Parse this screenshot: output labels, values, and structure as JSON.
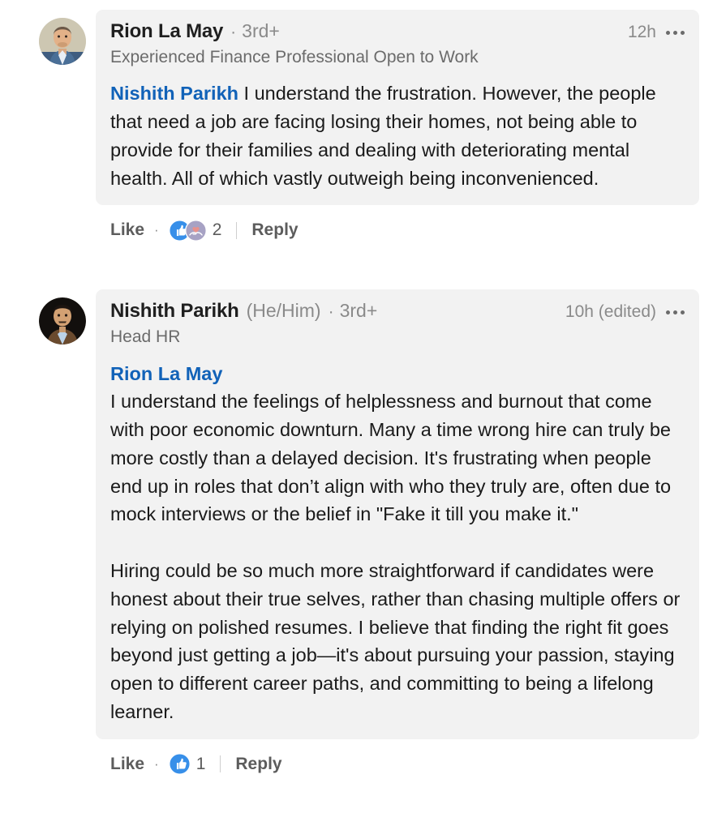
{
  "theme": {
    "bubble_bg": "#f2f2f2",
    "page_bg": "#ffffff",
    "mention_link": "#1162b8",
    "primary_text": "#1a1a1a",
    "muted_text": "#6b6b6b",
    "action_text": "#5c5c5c"
  },
  "comments": [
    {
      "author": "Rion La May",
      "pronouns": "",
      "degree_separator": "·",
      "degree": "3rd+",
      "headline": "Experienced Finance Professional Open to Work",
      "timestamp": "12h",
      "menu_icon": "ellipsis-icon",
      "mention": "Nishith Parikh",
      "mention_inline": true,
      "body": " I understand the frustration. However, the people that need a job are facing losing their homes, not being able to provide for their families and dealing with deteriorating mental health. All of which vastly outweigh being inconvenienced.",
      "paragraphs": [],
      "actions": {
        "like_label": "Like",
        "separator_dot": "·",
        "reply_label": "Reply",
        "reaction_count": "2",
        "reaction_icons": [
          "like-thumbs-up-icon",
          "support-heart-hands-icon"
        ]
      }
    },
    {
      "author": "Nishith Parikh",
      "pronouns": "(He/Him)",
      "degree_separator": "·",
      "degree": "3rd+",
      "headline": "Head HR",
      "timestamp": "10h (edited)",
      "menu_icon": "ellipsis-icon",
      "mention": "Rion La May",
      "mention_inline": false,
      "body": "",
      "paragraphs": [
        "I understand the feelings of helplessness and burnout that come with poor economic downturn. Many a time wrong hire can truly be more costly than a delayed decision. It's frustrating when people end up in roles that don’t align with who they truly are, often due to mock interviews or the belief in \"Fake it till you make it.\"",
        "Hiring could be so much more straightforward if candidates were honest about their true selves, rather than chasing multiple offers or relying on polished resumes. I believe that finding the right fit goes beyond just getting a job—it's about pursuing your passion, staying open to different career paths, and committing to being a lifelong learner."
      ],
      "actions": {
        "like_label": "Like",
        "separator_dot": "·",
        "reply_label": "Reply",
        "reaction_count": "1",
        "reaction_icons": [
          "like-thumbs-up-icon"
        ]
      }
    }
  ]
}
